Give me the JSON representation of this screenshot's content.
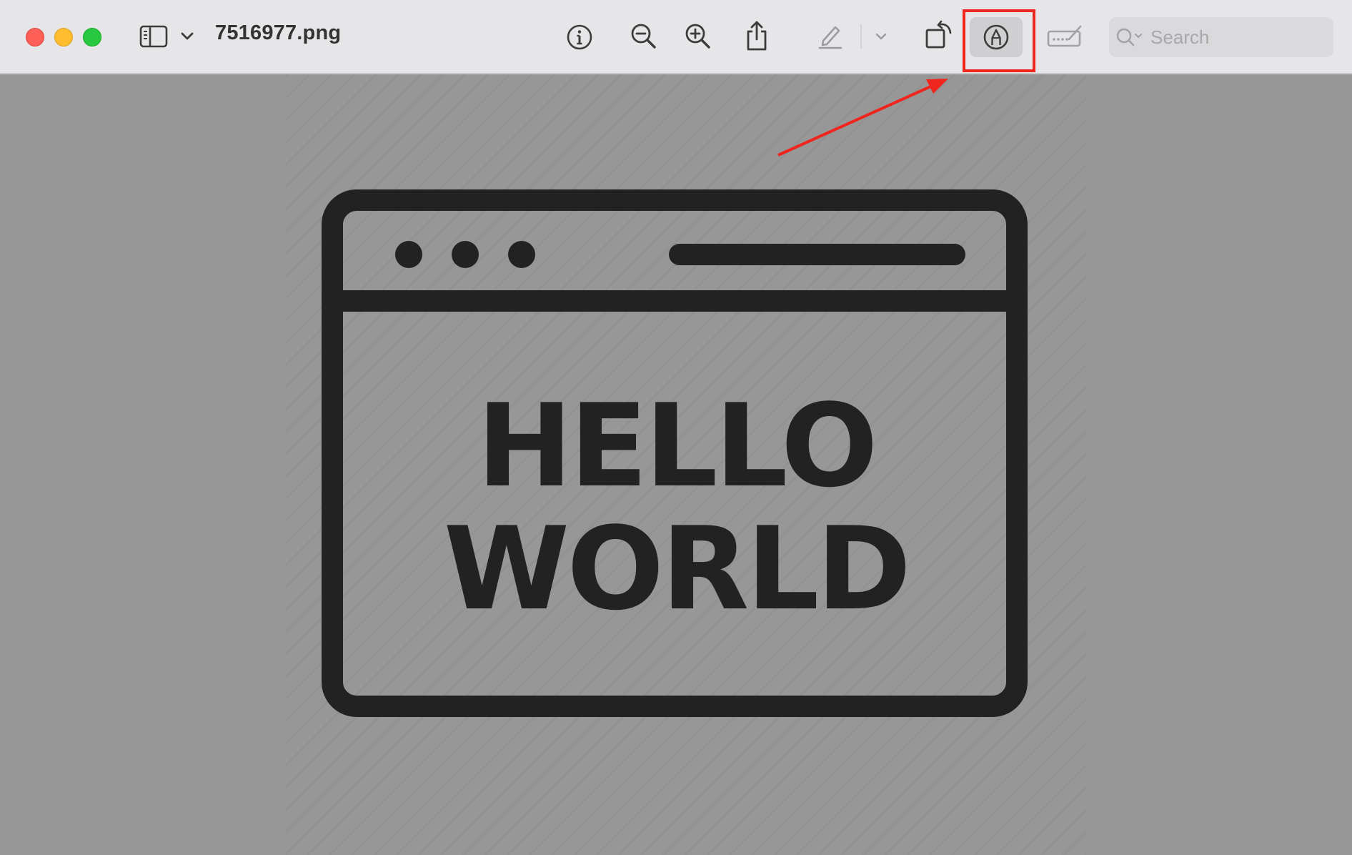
{
  "window": {
    "title": "7516977.png",
    "traffic_lights": [
      "close",
      "minimize",
      "zoom"
    ]
  },
  "toolbar": {
    "sidebar_toggle_icon": "sidebar-icon",
    "sidebar_menu_icon": "chevron-down-icon",
    "info_icon": "info-icon",
    "zoom_out_icon": "zoom-out-icon",
    "zoom_in_icon": "zoom-in-icon",
    "share_icon": "share-icon",
    "highlight_icon": "pen-icon",
    "highlight_menu_icon": "chevron-down-icon",
    "rotate_icon": "rotate-icon",
    "markup_icon": "markup-icon",
    "sign_icon": "signature-icon"
  },
  "search": {
    "placeholder": "Search"
  },
  "image_content": {
    "line1": "HELLO",
    "line2": "WORLD"
  },
  "colors": {
    "annotation_red": "#f0251d",
    "toolbar_bg": "#e6e6e8",
    "canvas_bg": "#979797",
    "ink": "#222222"
  }
}
